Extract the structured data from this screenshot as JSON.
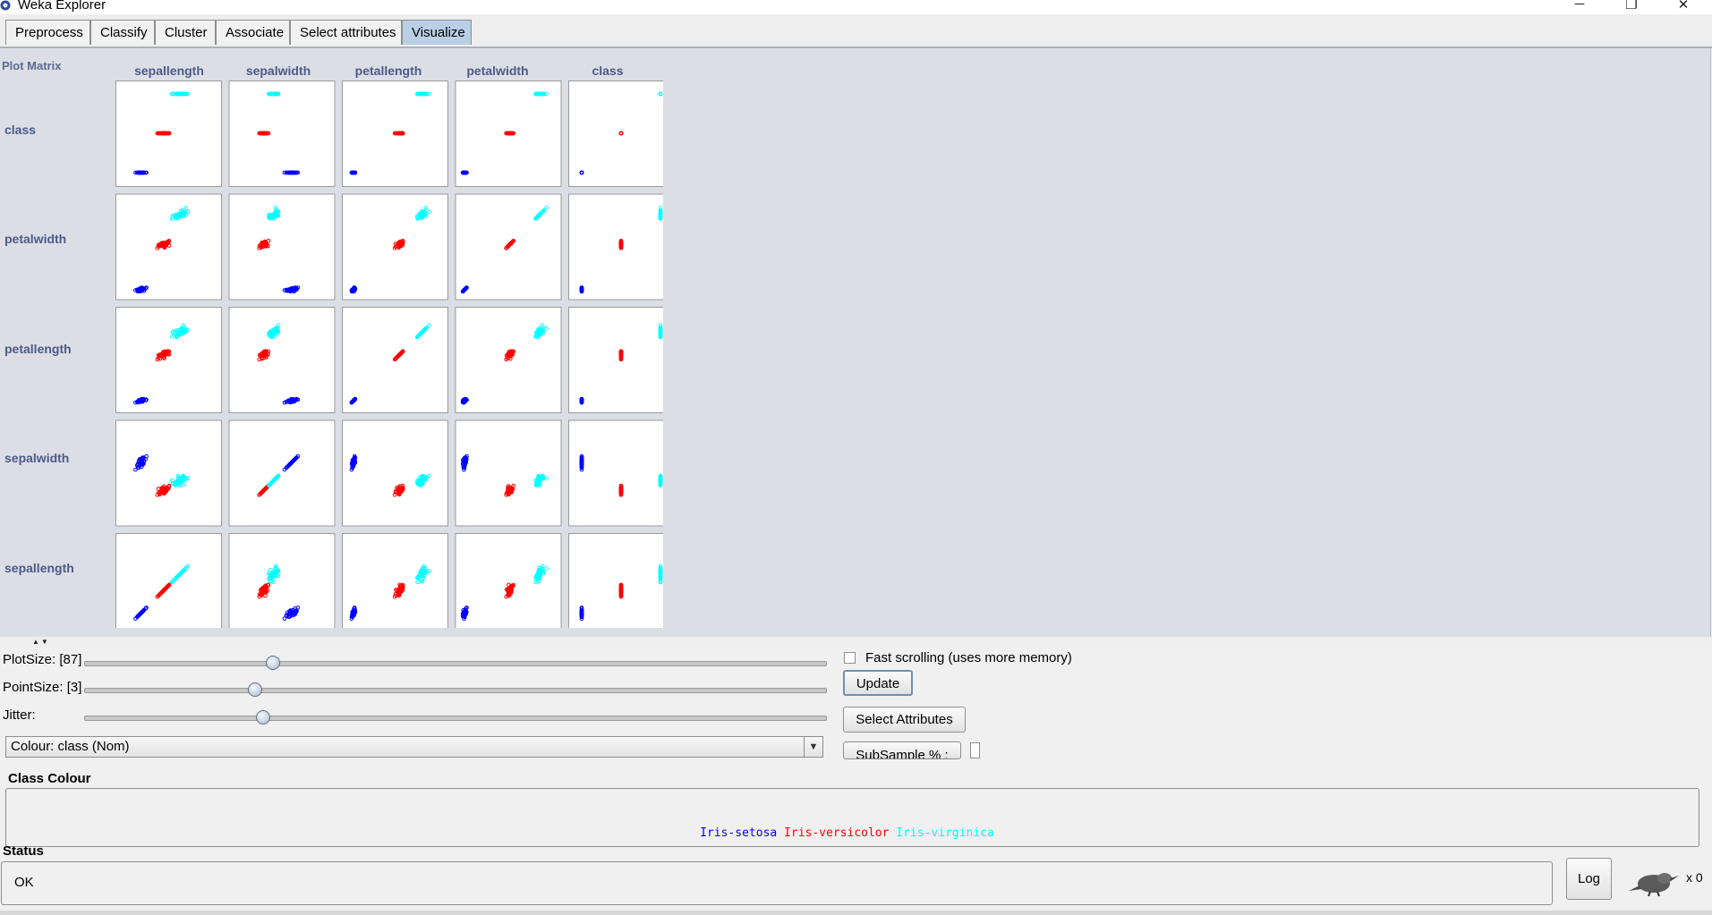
{
  "window": {
    "title": "Weka Explorer",
    "minimize": "─",
    "restore": "❐",
    "close": "✕"
  },
  "tabs": [
    {
      "label": "Preprocess",
      "active": false
    },
    {
      "label": "Classify",
      "active": false
    },
    {
      "label": "Cluster",
      "active": false
    },
    {
      "label": "Associate",
      "active": false
    },
    {
      "label": "Select attributes",
      "active": false
    },
    {
      "label": "Visualize",
      "active": true
    }
  ],
  "matrix": {
    "title": "Plot Matrix",
    "columns": [
      "sepallength",
      "sepalwidth",
      "petallength",
      "petalwidth",
      "class"
    ],
    "rows": [
      "class",
      "petalwidth",
      "petallength",
      "sepalwidth",
      "sepallength"
    ]
  },
  "controls": {
    "plot_size_label": "PlotSize: [87]",
    "plot_size_value": 0.25,
    "point_size_label": "PointSize: [3]",
    "point_size_value": 0.23,
    "jitter_label": "Jitter:",
    "jitter_value": 0.24,
    "colour_select": "Colour: class  (Nom)",
    "fast_scrolling_label": "Fast scrolling (uses more memory)",
    "fast_scrolling_checked": false,
    "update_button": "Update",
    "select_attributes_button": "Select Attributes",
    "subsample_button": "SubSample % :"
  },
  "class_colour": {
    "title": "Class Colour",
    "classes": [
      {
        "name": "Iris-setosa",
        "color": "#0000ff"
      },
      {
        "name": "Iris-versicolor",
        "color": "#ff0000"
      },
      {
        "name": "Iris-virginica",
        "color": "#00ffff"
      }
    ]
  },
  "status": {
    "title": "Status",
    "text": "OK",
    "log_button": "Log",
    "count": "x 0"
  },
  "colors": {
    "panel_bg": "#dcdee6",
    "label_color": "#4c5a86",
    "active_tab": "#b8cfe5"
  }
}
